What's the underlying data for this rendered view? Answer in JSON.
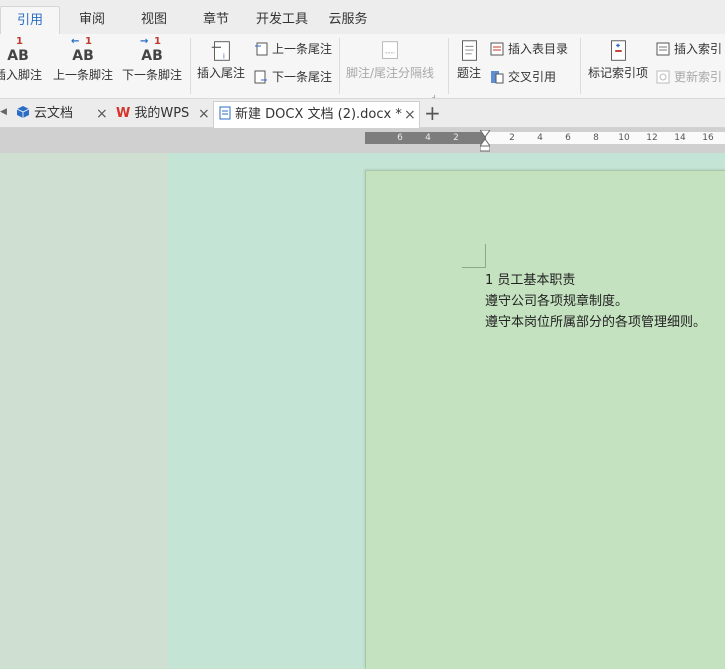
{
  "menu": {
    "tabs": [
      {
        "label": "引用",
        "active": true
      },
      {
        "label": "审阅"
      },
      {
        "label": "视图"
      },
      {
        "label": "章节"
      },
      {
        "label": "开发工具"
      },
      {
        "label": "云服务"
      }
    ]
  },
  "ribbon": {
    "insert_footnote": "插入脚注",
    "prev_footnote": "上一条脚注",
    "next_footnote": "下一条脚注",
    "insert_endnote": "插入尾注",
    "prev_endnote": "上一条尾注",
    "next_endnote": "下一条尾注",
    "separator_line": "脚注/尾注分隔线",
    "caption": "题注",
    "insert_table_of_figures": "插入表目录",
    "cross_reference": "交叉引用",
    "mark_index_entry": "标记索引项",
    "insert_index": "插入索引",
    "update_index": "更新索引"
  },
  "doc_tabs": {
    "cloud_docs": "云文档",
    "my_wps": "我的WPS",
    "current_doc": "新建 DOCX 文档 (2).docx *",
    "close": "×",
    "new_tab": "+"
  },
  "ruler": {
    "left_ticks": [
      "6",
      "4",
      "2"
    ],
    "right_ticks": [
      "2",
      "4",
      "6",
      "8",
      "10",
      "12",
      "14",
      "16"
    ]
  },
  "document": {
    "lines": [
      "1 员工基本职责",
      "遵守公司各项规章制度。",
      "遵守本岗位所属部分的各项管理细则。"
    ]
  },
  "colors": {
    "accent": "#2b6cc4",
    "page_bg": "#c5e2c0",
    "workspace_bg": "#c4e5d6"
  }
}
